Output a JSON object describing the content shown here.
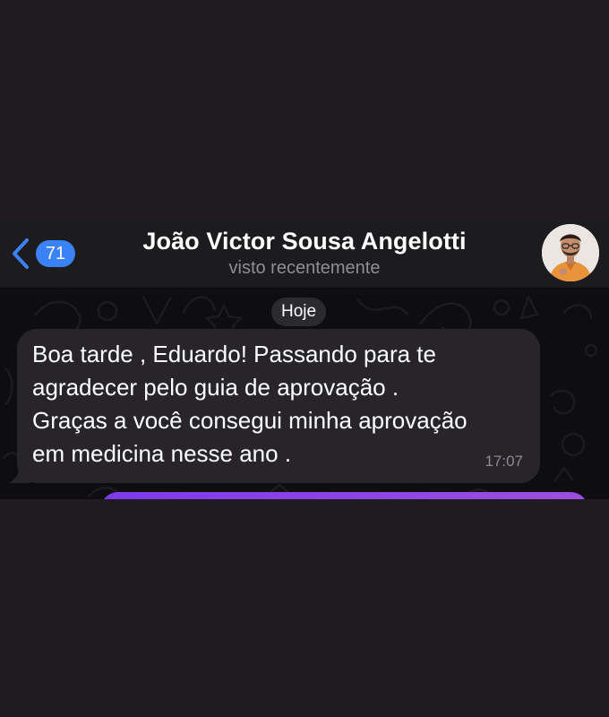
{
  "header": {
    "back_badge": "71",
    "contact_name": "João Victor Sousa Angelotti",
    "status": "visto recentemente"
  },
  "chat": {
    "date_separator": "Hoje",
    "message": {
      "lines": [
        "Boa tarde , Eduardo! Passando para te",
        "agradecer pelo guia de aprovação .",
        "Graças a você consegui minha aprovação",
        "em medicina nesse ano ."
      ],
      "time": "17:07"
    }
  },
  "colors": {
    "accent": "#3b82f6",
    "outgoing_bubble": "#8b45e6",
    "incoming_bubble": "#27252a",
    "background": "#1f1b20"
  },
  "icons": {
    "back": "chevron-left-icon",
    "avatar": "contact-avatar"
  }
}
